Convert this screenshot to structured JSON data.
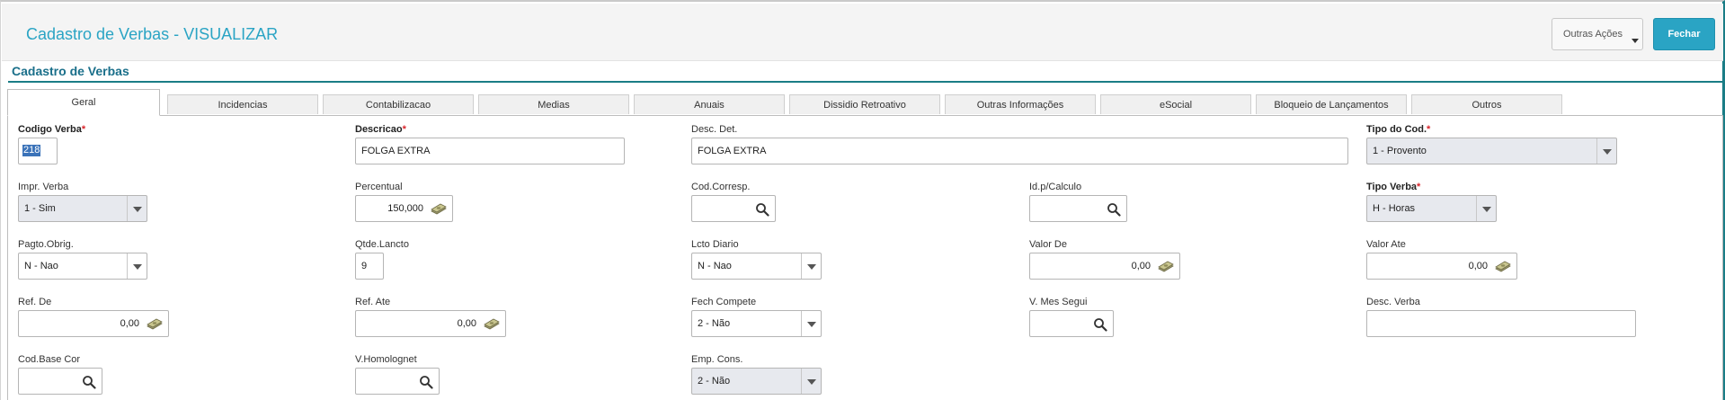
{
  "header": {
    "title": "Cadastro de Verbas - VISUALIZAR",
    "outras_acoes": "Outras Ações",
    "fechar": "Fechar"
  },
  "section": {
    "title": "Cadastro de Verbas"
  },
  "tabs": [
    {
      "label": "Geral"
    },
    {
      "label": "Incidencias"
    },
    {
      "label": "Contabilizacao"
    },
    {
      "label": "Medias"
    },
    {
      "label": "Anuais"
    },
    {
      "label": "Dissidio Retroativo"
    },
    {
      "label": "Outras Informações"
    },
    {
      "label": "eSocial"
    },
    {
      "label": "Bloqueio de Lançamentos"
    },
    {
      "label": "Outros"
    }
  ],
  "fields": {
    "codigo_verba": {
      "label": "Codigo Verba",
      "value": "218",
      "required": true
    },
    "descricao": {
      "label": "Descricao",
      "value": "FOLGA EXTRA",
      "required": true
    },
    "desc_det": {
      "label": "Desc. Det.",
      "value": "FOLGA EXTRA"
    },
    "tipo_cod": {
      "label": "Tipo do Cod.",
      "value": "1 - Provento",
      "required": true
    },
    "impr_verba": {
      "label": "Impr. Verba",
      "value": "1 - Sim"
    },
    "percentual": {
      "label": "Percentual",
      "value": "150,000"
    },
    "cod_corresp": {
      "label": "Cod.Corresp.",
      "value": ""
    },
    "id_calculo": {
      "label": "Id.p/Calculo",
      "value": ""
    },
    "tipo_verba": {
      "label": "Tipo Verba",
      "value": "H - Horas",
      "required": true
    },
    "pagto_obrig": {
      "label": "Pagto.Obrig.",
      "value": "N - Nao"
    },
    "qtde_lancto": {
      "label": "Qtde.Lancto",
      "value": "9"
    },
    "lcto_diario": {
      "label": "Lcto Diario",
      "value": "N - Nao"
    },
    "valor_de": {
      "label": "Valor De",
      "value": "0,00"
    },
    "valor_ate": {
      "label": "Valor Ate",
      "value": "0,00"
    },
    "ref_de": {
      "label": "Ref. De",
      "value": "0,00"
    },
    "ref_ate": {
      "label": "Ref. Ate",
      "value": "0,00"
    },
    "fech_compete": {
      "label": "Fech Compete",
      "value": "2 - Não"
    },
    "v_mes_segui": {
      "label": "V. Mes Segui",
      "value": ""
    },
    "desc_verba": {
      "label": "Desc. Verba",
      "value": ""
    },
    "cod_base_cor": {
      "label": "Cod.Base Cor",
      "value": ""
    },
    "v_homolognet": {
      "label": "V.Homolognet",
      "value": ""
    },
    "emp_cons": {
      "label": "Emp. Cons.",
      "value": "2 - Não"
    }
  },
  "icons": {
    "search": "search-icon",
    "money": "money-icon",
    "dropdown": "chevron-down-icon"
  },
  "colors": {
    "accent": "#2aa4c4",
    "section": "#1a6f8a",
    "required": "#d9262c"
  }
}
